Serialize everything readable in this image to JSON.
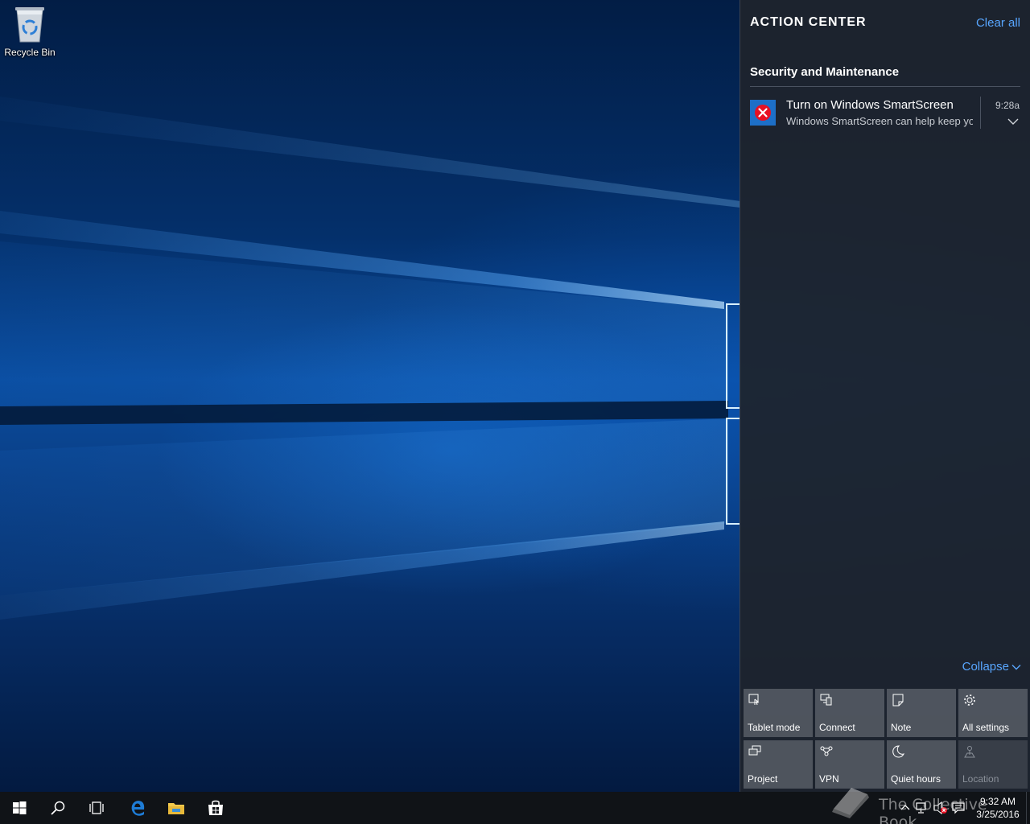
{
  "desktop": {
    "icons": [
      {
        "label": "Recycle Bin",
        "icon": "recycle-bin-icon"
      }
    ]
  },
  "action_center": {
    "title": "ACTION CENTER",
    "clear_all": "Clear all",
    "group": {
      "title": "Security and Maintenance",
      "notifications": [
        {
          "icon": "error-x-icon",
          "title": "Turn on Windows SmartScreen",
          "body": "Windows SmartScreen can help keep yo",
          "time": "9:28a"
        }
      ]
    },
    "collapse_label": "Collapse",
    "quick_actions": [
      {
        "label": "Tablet mode",
        "icon": "tablet-mode-icon",
        "enabled": true
      },
      {
        "label": "Connect",
        "icon": "connect-icon",
        "enabled": true
      },
      {
        "label": "Note",
        "icon": "note-icon",
        "enabled": true
      },
      {
        "label": "All settings",
        "icon": "gear-icon",
        "enabled": true
      },
      {
        "label": "Project",
        "icon": "project-icon",
        "enabled": true
      },
      {
        "label": "VPN",
        "icon": "vpn-icon",
        "enabled": true
      },
      {
        "label": "Quiet hours",
        "icon": "moon-icon",
        "enabled": true
      },
      {
        "label": "Location",
        "icon": "location-icon",
        "enabled": false
      }
    ]
  },
  "taskbar": {
    "pinned": [
      {
        "name": "start",
        "icon": "windows-logo-icon"
      },
      {
        "name": "search",
        "icon": "search-icon"
      },
      {
        "name": "task-view",
        "icon": "task-view-icon"
      },
      {
        "name": "edge",
        "icon": "edge-browser-icon"
      },
      {
        "name": "file-explorer",
        "icon": "folder-icon"
      },
      {
        "name": "store",
        "icon": "store-icon"
      }
    ],
    "tray": {
      "icons": [
        "chevron-up-icon",
        "network-icon",
        "volume-muted-icon",
        "action-center-icon"
      ],
      "time": "9:32 AM",
      "date": "3/25/2016"
    }
  },
  "watermark": {
    "text": "The Collective Book"
  },
  "colors": {
    "accent": "#58a6ff",
    "panel": "#1e242c",
    "taskbar": "#101317",
    "error": "#e81123"
  }
}
